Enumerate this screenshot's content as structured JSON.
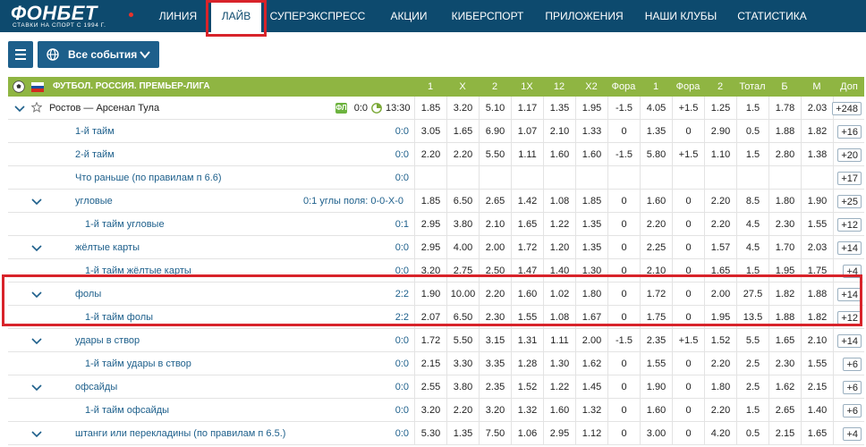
{
  "brand": {
    "name": "ФОНБЕТ",
    "tagline": "СТАВКИ НА СПОРТ С 1994 Г."
  },
  "nav": [
    "ЛИНИЯ",
    "ЛАЙВ",
    "СУПЕРЭКСПРЕСС",
    "АКЦИИ",
    "КИБЕРСПОРТ",
    "ПРИЛОЖЕНИЯ",
    "НАШИ КЛУБЫ",
    "СТАТИСТИКА"
  ],
  "nav_active": "ЛАЙВ",
  "toolbar": {
    "events_label": "Все события"
  },
  "league": "ФУТБОЛ. РОССИЯ. ПРЕМЬЕР-ЛИГА",
  "columns": [
    "1",
    "X",
    "2",
    "1X",
    "12",
    "X2",
    "Фора",
    "1",
    "Фора",
    "2",
    "Тотал",
    "Б",
    "М",
    "Доп"
  ],
  "colors": {
    "topbar": "#0d4a6e",
    "accent_green": "#8fb542",
    "link_blue": "#1d5f8b",
    "annotation_red": "#d8232a"
  },
  "rows": [
    {
      "label": "Ростов — Арсенал Тула",
      "kind": "match",
      "score": "0:0",
      "time": "13:30",
      "values": [
        "1.85",
        "3.20",
        "5.10",
        "1.17",
        "1.35",
        "1.95",
        "-1.5",
        "4.05",
        "+1.5",
        "1.25",
        "1.5",
        "1.78",
        "2.03"
      ],
      "more": "+248"
    },
    {
      "label": "1-й тайм",
      "kind": "sub",
      "score": "0:0",
      "values": [
        "3.05",
        "1.65",
        "6.90",
        "1.07",
        "2.10",
        "1.33",
        "0",
        "1.35",
        "0",
        "2.90",
        "0.5",
        "1.88",
        "1.82"
      ],
      "more": "+16"
    },
    {
      "label": "2-й тайм",
      "kind": "sub",
      "score": "0:0",
      "values": [
        "2.20",
        "2.20",
        "5.50",
        "1.11",
        "1.60",
        "1.60",
        "-1.5",
        "5.80",
        "+1.5",
        "1.10",
        "1.5",
        "2.80",
        "1.38"
      ],
      "more": "+20"
    },
    {
      "label": "Что раньше (по правилам п 6.6)",
      "kind": "sub",
      "score": "0:0",
      "values": [
        "",
        "",
        "",
        "",
        "",
        "",
        "",
        "",
        "",
        "",
        "",
        "",
        ""
      ],
      "more": "+17"
    },
    {
      "label": "угловые",
      "kind": "group",
      "score": "0:1",
      "extra": "углы поля: 0-0-Х-0",
      "values": [
        "1.85",
        "6.50",
        "2.65",
        "1.42",
        "1.08",
        "1.85",
        "0",
        "1.60",
        "0",
        "2.20",
        "8.5",
        "1.80",
        "1.90"
      ],
      "more": "+25"
    },
    {
      "label": "1-й тайм угловые",
      "kind": "sub2",
      "score": "0:1",
      "values": [
        "2.95",
        "3.80",
        "2.10",
        "1.65",
        "1.22",
        "1.35",
        "0",
        "2.20",
        "0",
        "2.20",
        "4.5",
        "2.30",
        "1.55"
      ],
      "more": "+12"
    },
    {
      "label": "жёлтые карты",
      "kind": "group",
      "score": "0:0",
      "values": [
        "2.95",
        "4.00",
        "2.00",
        "1.72",
        "1.20",
        "1.35",
        "0",
        "2.25",
        "0",
        "1.57",
        "4.5",
        "1.70",
        "2.03"
      ],
      "more": "+14"
    },
    {
      "label": "1-й тайм жёлтые карты",
      "kind": "sub2",
      "score": "0:0",
      "values": [
        "3.20",
        "2.75",
        "2.50",
        "1.47",
        "1.40",
        "1.30",
        "0",
        "2.10",
        "0",
        "1.65",
        "1.5",
        "1.95",
        "1.75"
      ],
      "more": "+4"
    },
    {
      "label": "фолы",
      "kind": "group",
      "score": "2:2",
      "values": [
        "1.90",
        "10.00",
        "2.20",
        "1.60",
        "1.02",
        "1.80",
        "0",
        "1.72",
        "0",
        "2.00",
        "27.5",
        "1.82",
        "1.88"
      ],
      "more": "+14"
    },
    {
      "label": "1-й тайм фолы",
      "kind": "sub2",
      "score": "2:2",
      "values": [
        "2.07",
        "6.50",
        "2.30",
        "1.55",
        "1.08",
        "1.67",
        "0",
        "1.75",
        "0",
        "1.95",
        "13.5",
        "1.88",
        "1.82"
      ],
      "more": "+12"
    },
    {
      "label": "удары в створ",
      "kind": "group",
      "score": "0:0",
      "values": [
        "1.72",
        "5.50",
        "3.15",
        "1.31",
        "1.11",
        "2.00",
        "-1.5",
        "2.35",
        "+1.5",
        "1.52",
        "5.5",
        "1.65",
        "2.10"
      ],
      "more": "+14"
    },
    {
      "label": "1-й тайм удары в створ",
      "kind": "sub2",
      "score": "0:0",
      "values": [
        "2.15",
        "3.30",
        "3.35",
        "1.28",
        "1.30",
        "1.62",
        "0",
        "1.55",
        "0",
        "2.20",
        "2.5",
        "2.30",
        "1.55"
      ],
      "more": "+6"
    },
    {
      "label": "офсайды",
      "kind": "group",
      "score": "0:0",
      "values": [
        "2.55",
        "3.80",
        "2.35",
        "1.52",
        "1.22",
        "1.45",
        "0",
        "1.90",
        "0",
        "1.80",
        "2.5",
        "1.62",
        "2.15"
      ],
      "more": "+6"
    },
    {
      "label": "1-й тайм офсайды",
      "kind": "sub2",
      "score": "0:0",
      "values": [
        "3.20",
        "2.20",
        "3.20",
        "1.32",
        "1.60",
        "1.32",
        "0",
        "1.60",
        "0",
        "2.20",
        "1.5",
        "2.65",
        "1.40"
      ],
      "more": "+6"
    },
    {
      "label": "штанги или перекладины (по правилам п 6.5.)",
      "kind": "group",
      "score": "0:0",
      "values": [
        "5.30",
        "1.35",
        "7.50",
        "1.06",
        "2.95",
        "1.12",
        "0",
        "3.00",
        "0",
        "4.20",
        "0.5",
        "2.15",
        "1.65"
      ],
      "more": "+4"
    }
  ]
}
